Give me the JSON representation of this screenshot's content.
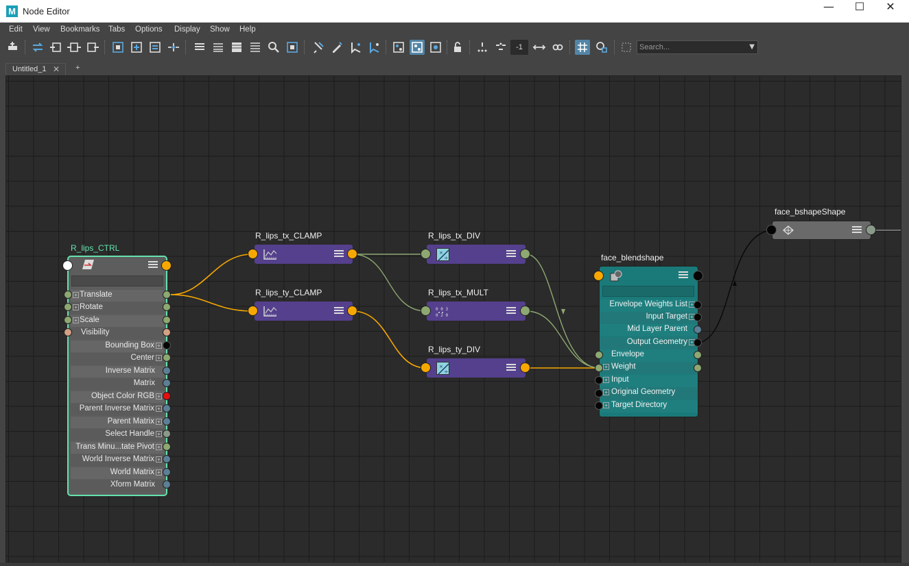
{
  "window": {
    "app_icon": "M",
    "title": "Node Editor",
    "minimize": "—",
    "maximize": "☐",
    "close": "✕"
  },
  "menu": [
    "Edit",
    "View",
    "Bookmarks",
    "Tabs",
    "Options",
    "Display",
    "Show",
    "Help"
  ],
  "toolbar": {
    "number_value": "-1",
    "search_placeholder": "Search...",
    "search_dropdown_icon": "chevron-down-icon"
  },
  "tabs": {
    "active_label": "Untitled_1",
    "close_glyph": "✕",
    "add_glyph": "+"
  },
  "colors": {
    "canvas": "#2b2b2b",
    "grid": "#1b1b1b",
    "selected_outline": "#64e3ae",
    "utility_node": "#54408d",
    "blendshape_node": "#1a7a7a",
    "orange_wire": "#f7a800",
    "green_wire": "#8da871"
  },
  "nodes": {
    "ctrl": {
      "title": "R_lips_CTRL",
      "attrs_left": [
        "Translate",
        "Rotate",
        "Scale",
        "Visibility"
      ],
      "attrs_right": [
        "Bounding Box",
        "Center",
        "Inverse Matrix",
        "Matrix",
        "Object Color RGB",
        "Parent Inverse Matrix",
        "Parent Matrix",
        "Select Handle",
        "Trans Minu...tate Pivot",
        "World Inverse Matrix",
        "World Matrix",
        "Xform Matrix"
      ]
    },
    "tx_clamp": {
      "title": "R_lips_tx_CLAMP",
      "icon": "clamp-icon"
    },
    "ty_clamp": {
      "title": "R_lips_ty_CLAMP",
      "icon": "clamp-icon"
    },
    "tx_div": {
      "title": "R_lips_tx_DIV",
      "icon": "divide-icon"
    },
    "tx_mult": {
      "title": "R_lips_tx_MULT",
      "icon": "multiply-icon"
    },
    "ty_div": {
      "title": "R_lips_ty_DIV",
      "icon": "divide-icon"
    },
    "blendshape": {
      "title": "face_blendshape",
      "attrs_right": [
        "Envelope Weights List",
        "Input Target",
        "Mid Layer Parent",
        "Output Geometry"
      ],
      "attrs_left": [
        "Envelope",
        "Weight",
        "Input",
        "Original Geometry",
        "Target Directory"
      ]
    },
    "shape": {
      "title": "face_bshapeShape",
      "icon": "mesh-icon"
    }
  }
}
